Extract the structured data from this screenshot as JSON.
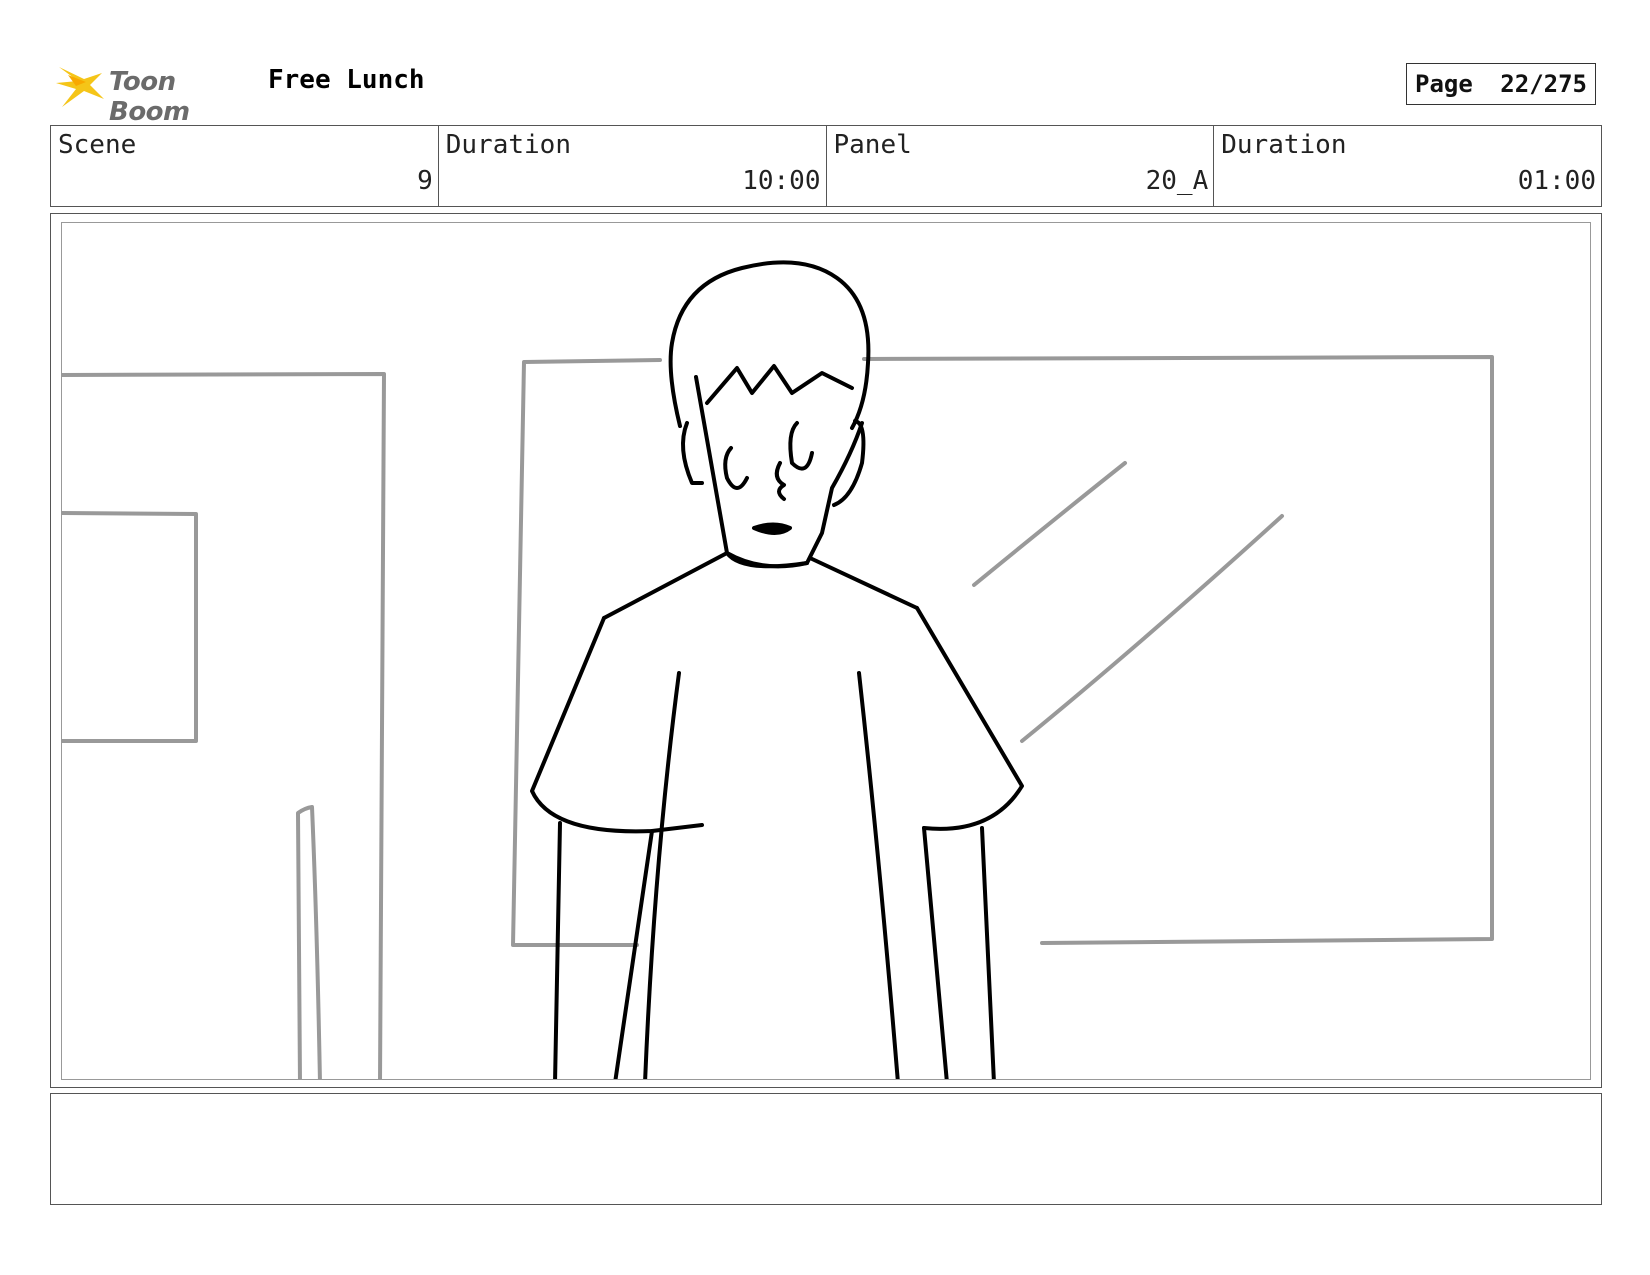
{
  "header": {
    "logo_text": "Toon Boom",
    "project_title": "Free Lunch",
    "page_label": "Page",
    "page_number": "22/275"
  },
  "info": {
    "scene_label": "Scene",
    "scene_value": "9",
    "scene_duration_label": "Duration",
    "scene_duration_value": "10:00",
    "panel_label": "Panel",
    "panel_value": "20_A",
    "panel_duration_label": "Duration",
    "panel_duration_value": "01:00"
  },
  "notes": {
    "text": ""
  },
  "colors": {
    "sketch": "#000000",
    "background_lines": "#999999",
    "logo_accent": "#f5c518"
  },
  "icons": {
    "logo": "toon-boom-star-icon"
  }
}
